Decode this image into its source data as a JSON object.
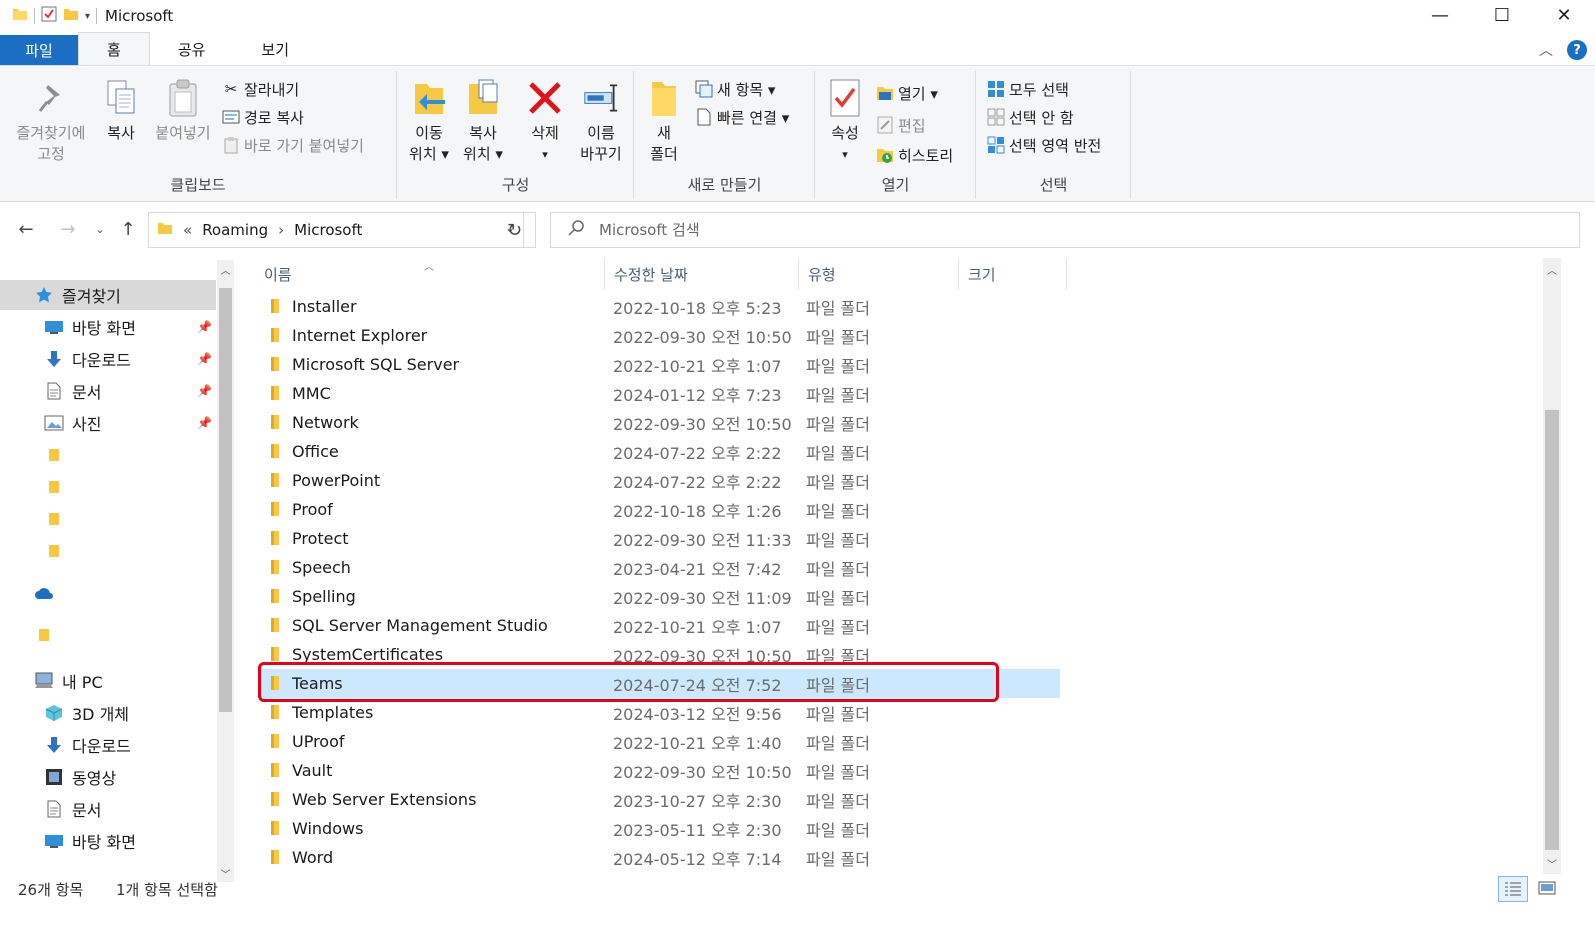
{
  "window": {
    "title": "Microsoft",
    "controls": {
      "minimize": "—",
      "maximize": "☐",
      "close": "✕"
    }
  },
  "ribbon_tabs": [
    {
      "label": "파일"
    },
    {
      "label": "홈"
    },
    {
      "label": "공유"
    },
    {
      "label": "보기"
    }
  ],
  "ribbon": {
    "clipboard": {
      "pin_label_1": "즐겨찾기에",
      "pin_label_2": "고정",
      "copy": "복사",
      "paste": "붙여넣기",
      "cut": "잘라내기",
      "copy_path": "경로 복사",
      "paste_shortcut": "바로 가기 붙여넣기",
      "group": "클립보드"
    },
    "organize": {
      "move_1": "이동",
      "move_2": "위치 ▾",
      "copyto_1": "복사",
      "copyto_2": "위치 ▾",
      "delete": "삭제",
      "delete_arrow": "▾",
      "rename_1": "이름",
      "rename_2": "바꾸기",
      "group": "구성"
    },
    "new": {
      "folder_1": "새",
      "folder_2": "폴더",
      "new_item": "새 항목 ▾",
      "easy_access": "빠른 연결 ▾",
      "group": "새로 만들기"
    },
    "open": {
      "properties": "속성",
      "properties_arrow": "▾",
      "open": "열기 ▾",
      "edit": "편집",
      "history": "히스토리",
      "group": "열기"
    },
    "select": {
      "select_all": "모두 선택",
      "select_none": "선택 안 함",
      "invert": "선택 영역 반전",
      "group": "선택"
    }
  },
  "address": {
    "chevrons": "«",
    "crumbs": [
      "Roaming",
      "Microsoft"
    ],
    "separator": "›"
  },
  "search": {
    "placeholder": "Microsoft 검색"
  },
  "nav_pane": {
    "items": [
      {
        "label": "즐겨찾기",
        "icon": "star-icon"
      },
      {
        "label": "바탕 화면",
        "icon": "desktop-icon"
      },
      {
        "label": "다운로드",
        "icon": "download-icon"
      },
      {
        "label": "문서",
        "icon": "document-icon"
      },
      {
        "label": "사진",
        "icon": "picture-icon"
      },
      {
        "label": "내 PC",
        "icon": "pc-icon"
      },
      {
        "label": "3D 개체",
        "icon": "cube-icon"
      },
      {
        "label": "다운로드",
        "icon": "download-icon"
      },
      {
        "label": "동영상",
        "icon": "video-icon"
      },
      {
        "label": "문서",
        "icon": "document-icon"
      },
      {
        "label": "바탕 화면",
        "icon": "desktop-icon"
      }
    ]
  },
  "columns": {
    "name": "이름",
    "date": "수정한 날짜",
    "type": "유형",
    "size": "크기"
  },
  "files": [
    {
      "name": "Installer",
      "date": "2022-10-18 오후 5:23",
      "type": "파일 폴더"
    },
    {
      "name": "Internet Explorer",
      "date": "2022-09-30 오전 10:50",
      "type": "파일 폴더"
    },
    {
      "name": "Microsoft SQL Server",
      "date": "2022-10-21 오후 1:07",
      "type": "파일 폴더"
    },
    {
      "name": "MMC",
      "date": "2024-01-12 오후 7:23",
      "type": "파일 폴더"
    },
    {
      "name": "Network",
      "date": "2022-09-30 오전 10:50",
      "type": "파일 폴더"
    },
    {
      "name": "Office",
      "date": "2024-07-22 오후 2:22",
      "type": "파일 폴더"
    },
    {
      "name": "PowerPoint",
      "date": "2024-07-22 오후 2:22",
      "type": "파일 폴더"
    },
    {
      "name": "Proof",
      "date": "2022-10-18 오후 1:26",
      "type": "파일 폴더"
    },
    {
      "name": "Protect",
      "date": "2022-09-30 오전 11:33",
      "type": "파일 폴더"
    },
    {
      "name": "Speech",
      "date": "2023-04-21 오전 7:42",
      "type": "파일 폴더"
    },
    {
      "name": "Spelling",
      "date": "2022-09-30 오전 11:09",
      "type": "파일 폴더"
    },
    {
      "name": "SQL Server Management Studio",
      "date": "2022-10-21 오후 1:07",
      "type": "파일 폴더"
    },
    {
      "name": "SystemCertificates",
      "date": "2022-09-30 오전 10:50",
      "type": "파일 폴더"
    },
    {
      "name": "Teams",
      "date": "2024-07-24 오전 7:52",
      "type": "파일 폴더",
      "selected": true
    },
    {
      "name": "Templates",
      "date": "2024-03-12 오전 9:56",
      "type": "파일 폴더"
    },
    {
      "name": "UProof",
      "date": "2022-10-21 오후 1:40",
      "type": "파일 폴더"
    },
    {
      "name": "Vault",
      "date": "2022-09-30 오전 10:50",
      "type": "파일 폴더"
    },
    {
      "name": "Web Server Extensions",
      "date": "2023-10-27 오후 2:30",
      "type": "파일 폴더"
    },
    {
      "name": "Windows",
      "date": "2023-05-11 오후 2:30",
      "type": "파일 폴더"
    },
    {
      "name": "Word",
      "date": "2024-05-12 오후 7:14",
      "type": "파일 폴더"
    }
  ],
  "status": {
    "item_count": "26개 항목",
    "selected_count": "1개 항목 선택함"
  },
  "colors": {
    "accent": "#1a6fc4",
    "selection": "#cce8ff",
    "highlight_box": "#e2001a",
    "folder": "#f7c842"
  }
}
